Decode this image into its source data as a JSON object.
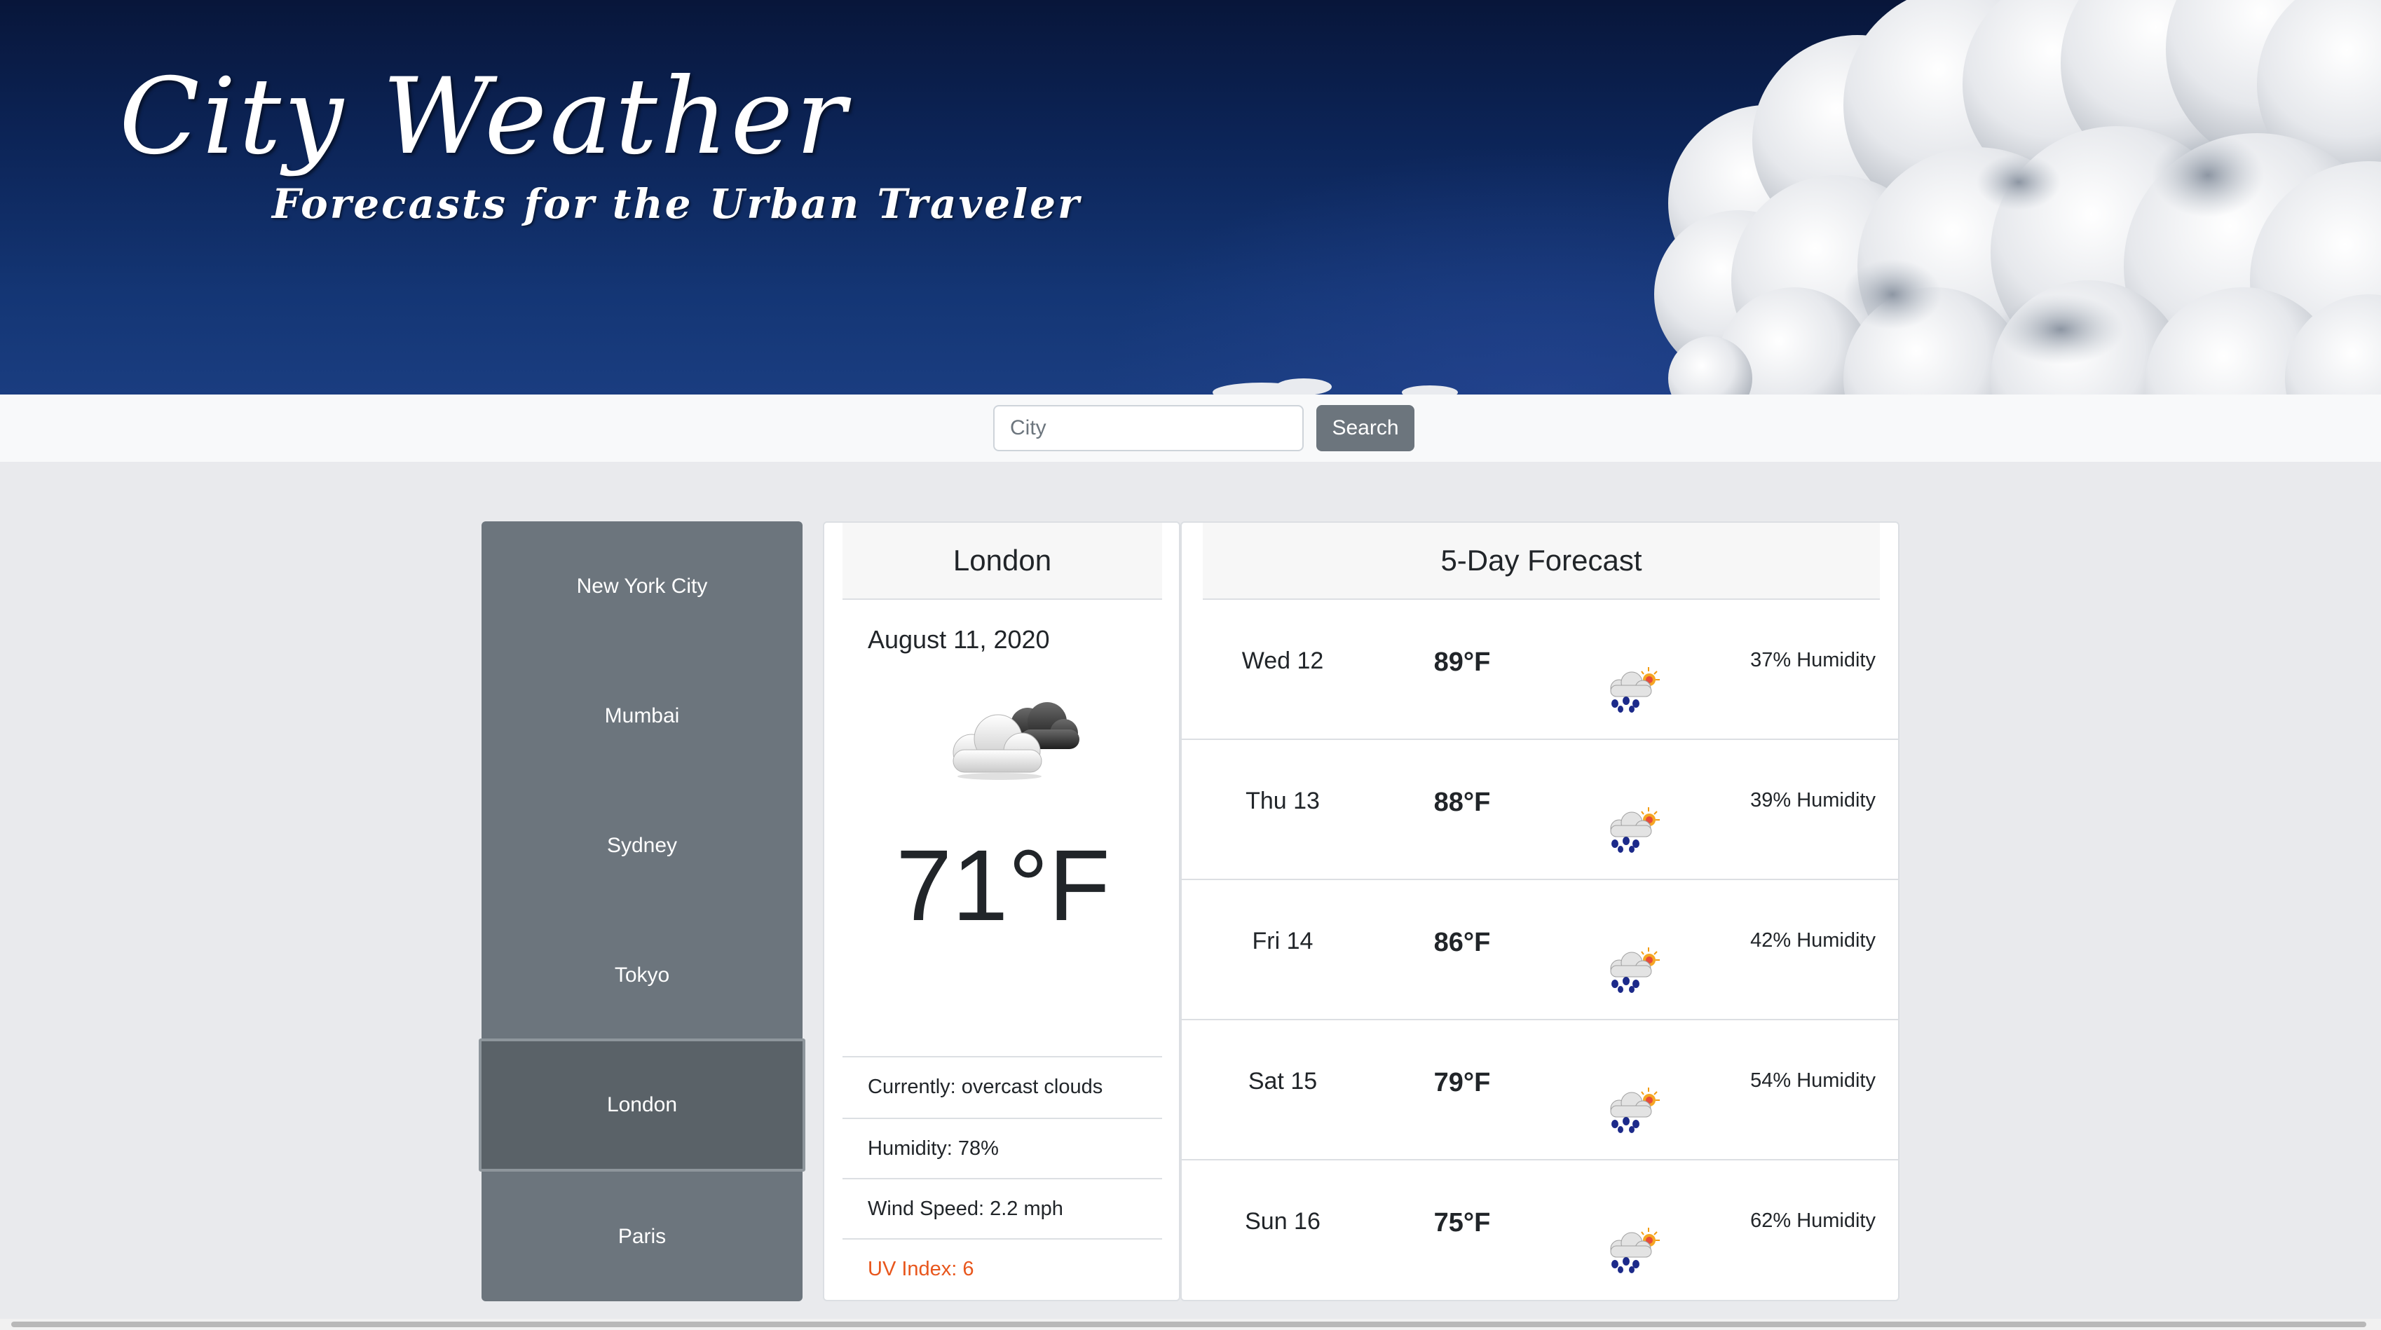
{
  "header": {
    "title": "City Weather",
    "subtitle": "Forecasts for the Urban Traveler"
  },
  "search": {
    "placeholder": "City",
    "value": "",
    "button_label": "Search"
  },
  "cities": [
    {
      "label": "New York City",
      "active": false
    },
    {
      "label": "Mumbai",
      "active": false
    },
    {
      "label": "Sydney",
      "active": false
    },
    {
      "label": "Tokyo",
      "active": false
    },
    {
      "label": "London",
      "active": true
    },
    {
      "label": "Paris",
      "active": false
    }
  ],
  "current": {
    "city": "London",
    "date": "August 11, 2020",
    "icon": "overcast-clouds-icon",
    "temperature": "71°F",
    "conditions": "Currently: overcast clouds",
    "humidity": "Humidity: 78%",
    "wind": "Wind Speed: 2.2 mph",
    "uv": "UV Index: 6",
    "uv_color": "#e8561c"
  },
  "forecast": {
    "title": "5-Day Forecast",
    "days": [
      {
        "day": "Wed 12",
        "temp": "89°F",
        "icon": "thunderstorm-sun-icon",
        "humidity": "37% Humidity"
      },
      {
        "day": "Thu 13",
        "temp": "88°F",
        "icon": "thunderstorm-sun-icon",
        "humidity": "39% Humidity"
      },
      {
        "day": "Fri 14",
        "temp": "86°F",
        "icon": "thunderstorm-sun-icon",
        "humidity": "42% Humidity"
      },
      {
        "day": "Sat 15",
        "temp": "79°F",
        "icon": "thunderstorm-sun-icon",
        "humidity": "54% Humidity"
      },
      {
        "day": "Sun 16",
        "temp": "75°F",
        "icon": "thunderstorm-sun-icon",
        "humidity": "62% Humidity"
      }
    ]
  },
  "colors": {
    "sidebar": "#6c757d",
    "sidebar_active": "#5a6268",
    "banner": "#0c2457"
  }
}
